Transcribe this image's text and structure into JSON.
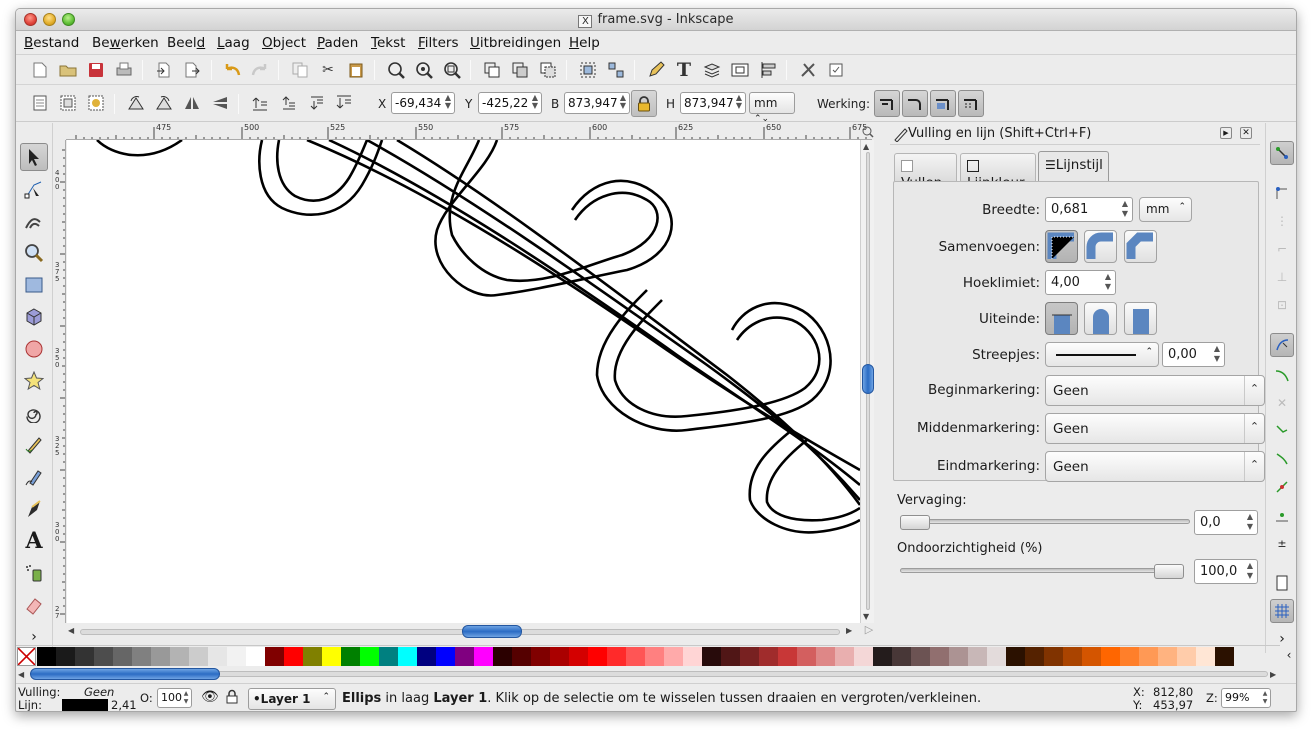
{
  "window": {
    "title": "frame.svg - Inkscape"
  },
  "menu": [
    {
      "label": "Bestand",
      "u": "B"
    },
    {
      "label": "Bewerken",
      "u": "w"
    },
    {
      "label": "Beeld",
      "u": "d"
    },
    {
      "label": "Laag",
      "u": "L"
    },
    {
      "label": "Object",
      "u": "O"
    },
    {
      "label": "Paden",
      "u": "P"
    },
    {
      "label": "Tekst",
      "u": "T"
    },
    {
      "label": "Filters",
      "u": "F"
    },
    {
      "label": "Uitbreidingen",
      "u": "U"
    },
    {
      "label": "Help",
      "u": "H"
    }
  ],
  "controls": {
    "x_label": "X",
    "x_value": "-69,434",
    "y_label": "Y",
    "y_value": "-425,22",
    "w_label": "B",
    "w_value": "873,947",
    "h_label": "H",
    "h_value": "873,947",
    "unit": "mm",
    "werking_label": "Werking:"
  },
  "ruler": {
    "h_labels": [
      "475",
      "500",
      "525",
      "550",
      "575",
      "600",
      "625",
      "650",
      "675"
    ],
    "v_labels": [
      "4 0 0",
      "3 7 5",
      "3 5 0",
      "3 2 5",
      "3 0 0",
      "2 7"
    ]
  },
  "dock": {
    "title": "Vulling en lijn (Shift+Ctrl+F)",
    "tabs": {
      "fill": "Vullen",
      "stroke_paint": "Lijnkleur",
      "stroke_style": "Lijnstijl"
    },
    "width_label": "Breedte:",
    "width_value": "0,681",
    "width_unit": "mm",
    "join_label": "Samenvoegen:",
    "miter_label": "Hoeklimiet:",
    "miter_value": "4,00",
    "cap_label": "Uiteinde:",
    "dashes_label": "Streepjes:",
    "dash_offset": "0,00",
    "start_marker_label": "Beginmarkering:",
    "start_marker_value": "Geen",
    "mid_marker_label": "Middenmarkering:",
    "mid_marker_value": "Geen",
    "end_marker_label": "Eindmarkering:",
    "end_marker_value": "Geen",
    "blur_label": "Vervaging:",
    "blur_value": "0,0",
    "blur_fraction": 0.0,
    "opacity_label": "Ondoorzichtigheid (%)",
    "opacity_value": "100,0",
    "opacity_fraction": 1.0
  },
  "status": {
    "fill_label": "Vulling:",
    "fill_value": "Geen",
    "stroke_label": "Lijn:",
    "stroke_width": "2,41",
    "opacity_label": "O:",
    "opacity_value": "100",
    "layer": "•Layer 1",
    "message_bold1": "Ellips",
    "message_mid": " in laag ",
    "message_bold2": "Layer 1",
    "message_rest": ". Klik op de selectie om te wisselen tussen draaien en vergroten/verkleinen.",
    "x_label": "X:",
    "x_value": "812,80",
    "y_label": "Y:",
    "y_value": "453,97",
    "zoom_label": "Z:",
    "zoom_value": "99%"
  },
  "palette": {
    "colors": [
      "#000000",
      "#1a1a1a",
      "#333333",
      "#4d4d4d",
      "#666666",
      "#808080",
      "#999999",
      "#b3b3b3",
      "#cccccc",
      "#e6e6e6",
      "#f2f2f2",
      "#ffffff",
      "#800000",
      "#ff0000",
      "#808000",
      "#ffff00",
      "#008000",
      "#00ff00",
      "#008080",
      "#00ffff",
      "#000080",
      "#0000ff",
      "#800080",
      "#ff00ff",
      "#2b0000",
      "#550000",
      "#800000",
      "#aa0000",
      "#d40000",
      "#ff0000",
      "#ff2a2a",
      "#ff5555",
      "#ff8080",
      "#ffaaaa",
      "#ffd5d5",
      "#280b0b",
      "#501616",
      "#782121",
      "#a02c2c",
      "#c83737",
      "#d35f5f",
      "#de8787",
      "#e9afaf",
      "#f4d7d7",
      "#241c1c",
      "#483737",
      "#6c5353",
      "#916f6f",
      "#ac9393",
      "#c8b7b7",
      "#e3dbdb",
      "#2b1100",
      "#552200",
      "#803300",
      "#aa4400",
      "#d45500",
      "#ff6600",
      "#ff7f2a",
      "#ff9955",
      "#ffb380",
      "#ffccaa",
      "#ffe6d5",
      "#2b1100"
    ]
  }
}
